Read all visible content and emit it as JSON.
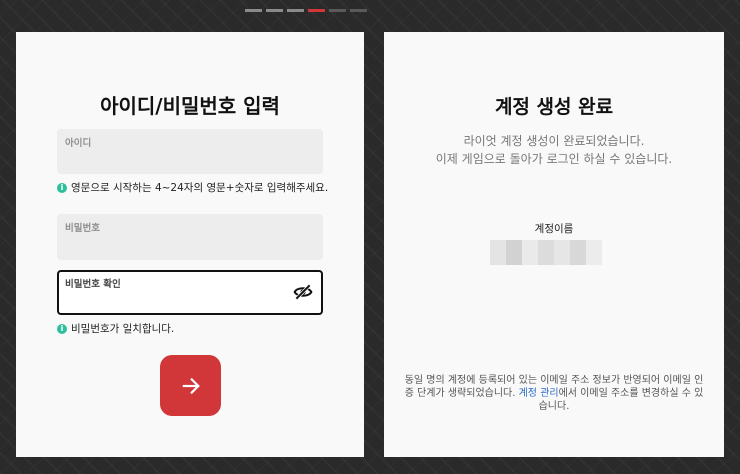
{
  "progress": {
    "total": 6,
    "active_index": 3
  },
  "left": {
    "title": "아이디/비밀번호 입력",
    "id_field": {
      "label": "아이디",
      "value": ""
    },
    "id_hint": "영문으로 시작하는 4~24자의 영문+숫자로 입력해주세요.",
    "pw_field": {
      "label": "비밀번호",
      "value": ""
    },
    "pw_confirm_field": {
      "label": "비밀번호 확인",
      "value": ""
    },
    "pw_hint": "비밀번호가 일치합니다.",
    "next_button_icon": "arrow-right-icon",
    "accent_color": "#d13639",
    "hint_color": "#2fbf9c"
  },
  "right": {
    "title": "계정 생성 완료",
    "desc_line1": "라이엇 계정 생성이 완료되었습니다.",
    "desc_line2": "이제 게임으로 돌아가 로그인 하실 수 있습니다.",
    "account_name_label": "계정이름",
    "footer_part1": "동일 명의 계정에 등록되어 있는 이메일 주소 정보가 반영되어 이메일 인증 단계가 생략되었습니다. ",
    "footer_link": "계정 관리",
    "footer_part2": "에서 이메일 주소를 변경하실 수 있습니다."
  }
}
